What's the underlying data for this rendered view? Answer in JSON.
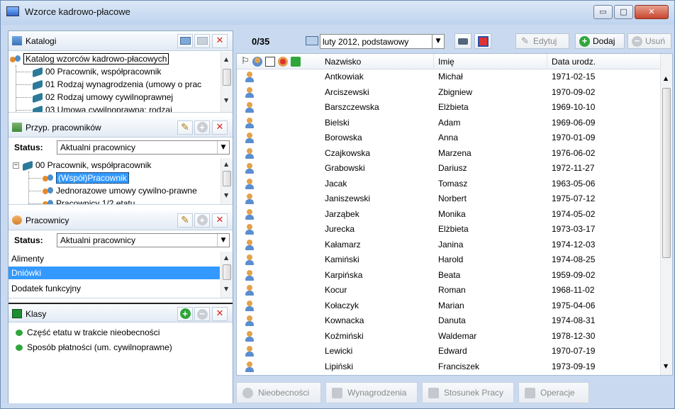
{
  "window": {
    "title": "Wzorce kadrowo-płacowe",
    "controls": {
      "minimize": "▭",
      "maximize": "□",
      "close": "✕"
    }
  },
  "katalogi": {
    "title": "Katalogi",
    "tree": {
      "root": "Katalog wzorców kadrowo-płacowych",
      "items": [
        "00 Pracownik, współpracownik",
        "01 Rodzaj wynagrodzenia (umowy o prac",
        "02 Rodzaj umowy cywilnoprawnej",
        "03 Umowa cywilnoprawna: rodzaj"
      ]
    }
  },
  "przyp": {
    "title": "Przyp. pracowników",
    "status_label": "Status:",
    "status_value": "Aktualni pracownicy",
    "tree": {
      "root": "00 Pracownik, współpracownik",
      "expander": "−",
      "items": [
        "(Współ)Pracownik",
        "Jednorazowe umowy cywilno-prawne",
        "Pracownicy 1/2 etatu"
      ]
    }
  },
  "pracownicy": {
    "title": "Pracownicy",
    "status_label": "Status:",
    "status_value": "Aktualni pracownicy",
    "items": [
      "Alimenty",
      "Dniówki",
      "Dodatek funkcyjny"
    ],
    "selected_index": 1
  },
  "klasy": {
    "title": "Klasy",
    "items": [
      "Część etatu w trakcie nieobecności",
      "Sposób płatności (um. cywilnoprawne)"
    ]
  },
  "toolbar": {
    "counter": "0/35",
    "period": "luty 2012, podstawowy",
    "edit_label": "Edytuj",
    "add_label": "Dodaj",
    "remove_label": "Usuń"
  },
  "grid": {
    "headers": {
      "surname": "Nazwisko",
      "name": "Imię",
      "birth": "Data urodz."
    },
    "rows": [
      [
        "Antkowiak",
        "Michał",
        "1971-02-15"
      ],
      [
        "Arciszewski",
        "Zbigniew",
        "1970-09-02"
      ],
      [
        "Barszczewska",
        "Elżbieta",
        "1969-10-10"
      ],
      [
        "Bielski",
        "Adam",
        "1969-06-09"
      ],
      [
        "Borowska",
        "Anna",
        "1970-01-09"
      ],
      [
        "Czajkowska",
        "Marzena",
        "1976-06-02"
      ],
      [
        "Grabowski",
        "Dariusz",
        "1972-11-27"
      ],
      [
        "Jacak",
        "Tomasz",
        "1963-05-06"
      ],
      [
        "Janiszewski",
        "Norbert",
        "1975-07-12"
      ],
      [
        "Jarząbek",
        "Monika",
        "1974-05-02"
      ],
      [
        "Jurecka",
        "Elżbieta",
        "1973-03-17"
      ],
      [
        "Kałamarz",
        "Janina",
        "1974-12-03"
      ],
      [
        "Kamiński",
        "Harold",
        "1974-08-25"
      ],
      [
        "Karpińska",
        "Beata",
        "1959-09-02"
      ],
      [
        "Kocur",
        "Roman",
        "1968-11-02"
      ],
      [
        "Kołaczyk",
        "Marian",
        "1975-04-06"
      ],
      [
        "Kownacka",
        "Danuta",
        "1974-08-31"
      ],
      [
        "Koźmiński",
        "Waldemar",
        "1978-12-30"
      ],
      [
        "Lewicki",
        "Edward",
        "1970-07-19"
      ],
      [
        "Lipiński",
        "Franciszek",
        "1973-09-19"
      ]
    ]
  },
  "bottom": {
    "nieobecnosci": "Nieobecności",
    "wynagrodzenia": "Wynagrodzenia",
    "stosunek": "Stosunek Pracy",
    "operacje": "Operacje"
  },
  "scroll_arrows": {
    "up": "▲",
    "down": "▼"
  },
  "colors": {
    "selection": "#3399ff",
    "accent_green": "#2fa63a",
    "delete_red": "#d8231a"
  }
}
